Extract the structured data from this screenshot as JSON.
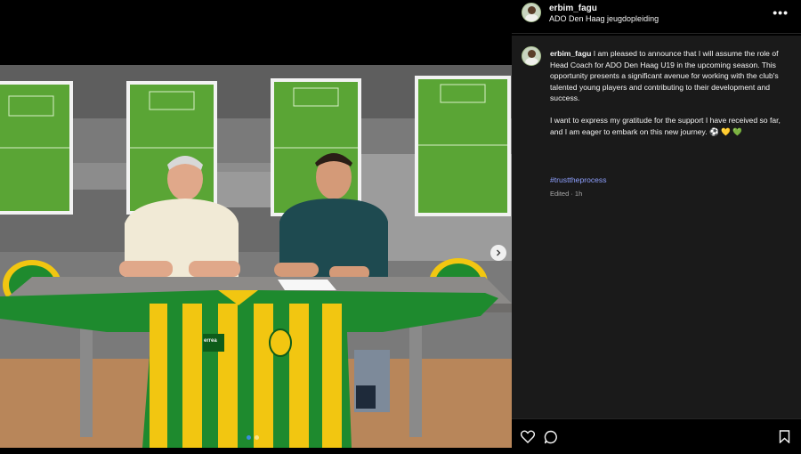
{
  "post": {
    "username": "erbim_fagu",
    "location": "ADO Den Haag jeugdopleiding",
    "caption_p1": "I am pleased to announce that I will assume the role of Head Coach for ADO Den Haag U19 in the upcoming season. This opportunity presents a significant avenue for working with the club's talented young players and contributing to their development and success.",
    "caption_p2": "I want to express my gratitude for the support I have received so far, and I am eager to embark on this new journey. ⚽ 💛 💚",
    "hashtag": "#trusttheprocess",
    "edited_label": "Edited · 1h",
    "more_label": "•••"
  },
  "photo": {
    "jersey_brand": "errea",
    "carousel_count": 2,
    "carousel_active": 0
  },
  "colors": {
    "ado_green": "#1e8a2e",
    "ado_yellow": "#f2c611",
    "hashtag_blue": "#8ea0ff",
    "panel_bg": "#1a1a1a"
  },
  "icons": {
    "like": "heart-icon",
    "comment": "comment-icon",
    "save": "bookmark-icon",
    "next": "chevron-right-icon"
  }
}
